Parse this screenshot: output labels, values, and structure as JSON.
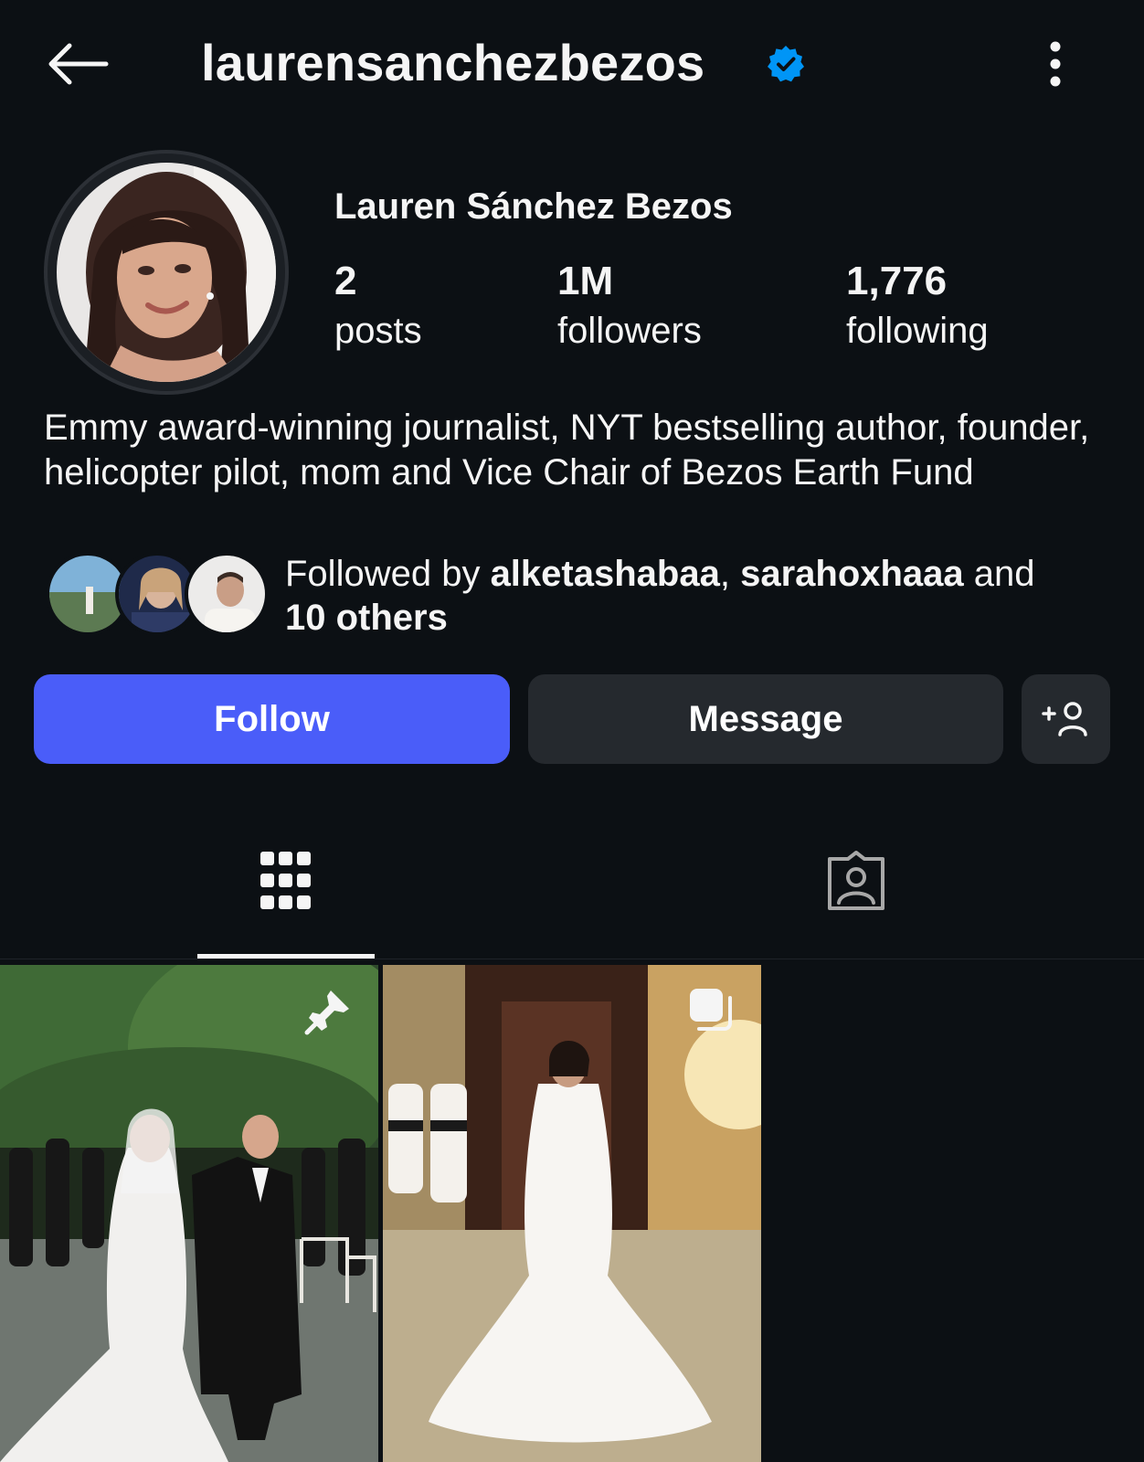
{
  "header": {
    "username": "laurensanchezbezos",
    "verified": true,
    "back_icon": "arrow-left-icon",
    "more_icon": "more-vertical-icon"
  },
  "profile": {
    "display_name": "Lauren Sánchez Bezos",
    "stats": {
      "posts": {
        "value": "2",
        "label": "posts"
      },
      "followers": {
        "value": "1M",
        "label": "followers"
      },
      "following": {
        "value": "1,776",
        "label": "following"
      }
    },
    "bio": "Emmy award-winning journalist, NYT bestselling author, founder, helicopter pilot, mom and Vice Chair of Bezos Earth Fund",
    "followed_by": {
      "prefix": "Followed by ",
      "user1": "alketashabaa",
      "separator": ", ",
      "user2": "sarahoxhaaa",
      "joiner": " and",
      "others": "10 others"
    }
  },
  "actions": {
    "follow_label": "Follow",
    "message_label": "Message",
    "add_user_icon": "add-person-icon"
  },
  "tabs": [
    {
      "icon": "grid-icon",
      "active": true
    },
    {
      "icon": "tagged-person-icon",
      "active": false
    }
  ],
  "posts": [
    {
      "badge": "pin-icon"
    },
    {
      "badge": "carousel-icon"
    }
  ],
  "colors": {
    "background": "#0c1014",
    "follow_button": "#4a5df9",
    "secondary_button": "#25292e",
    "verified_badge": "#0095f6",
    "text": "#f5f5f5"
  }
}
